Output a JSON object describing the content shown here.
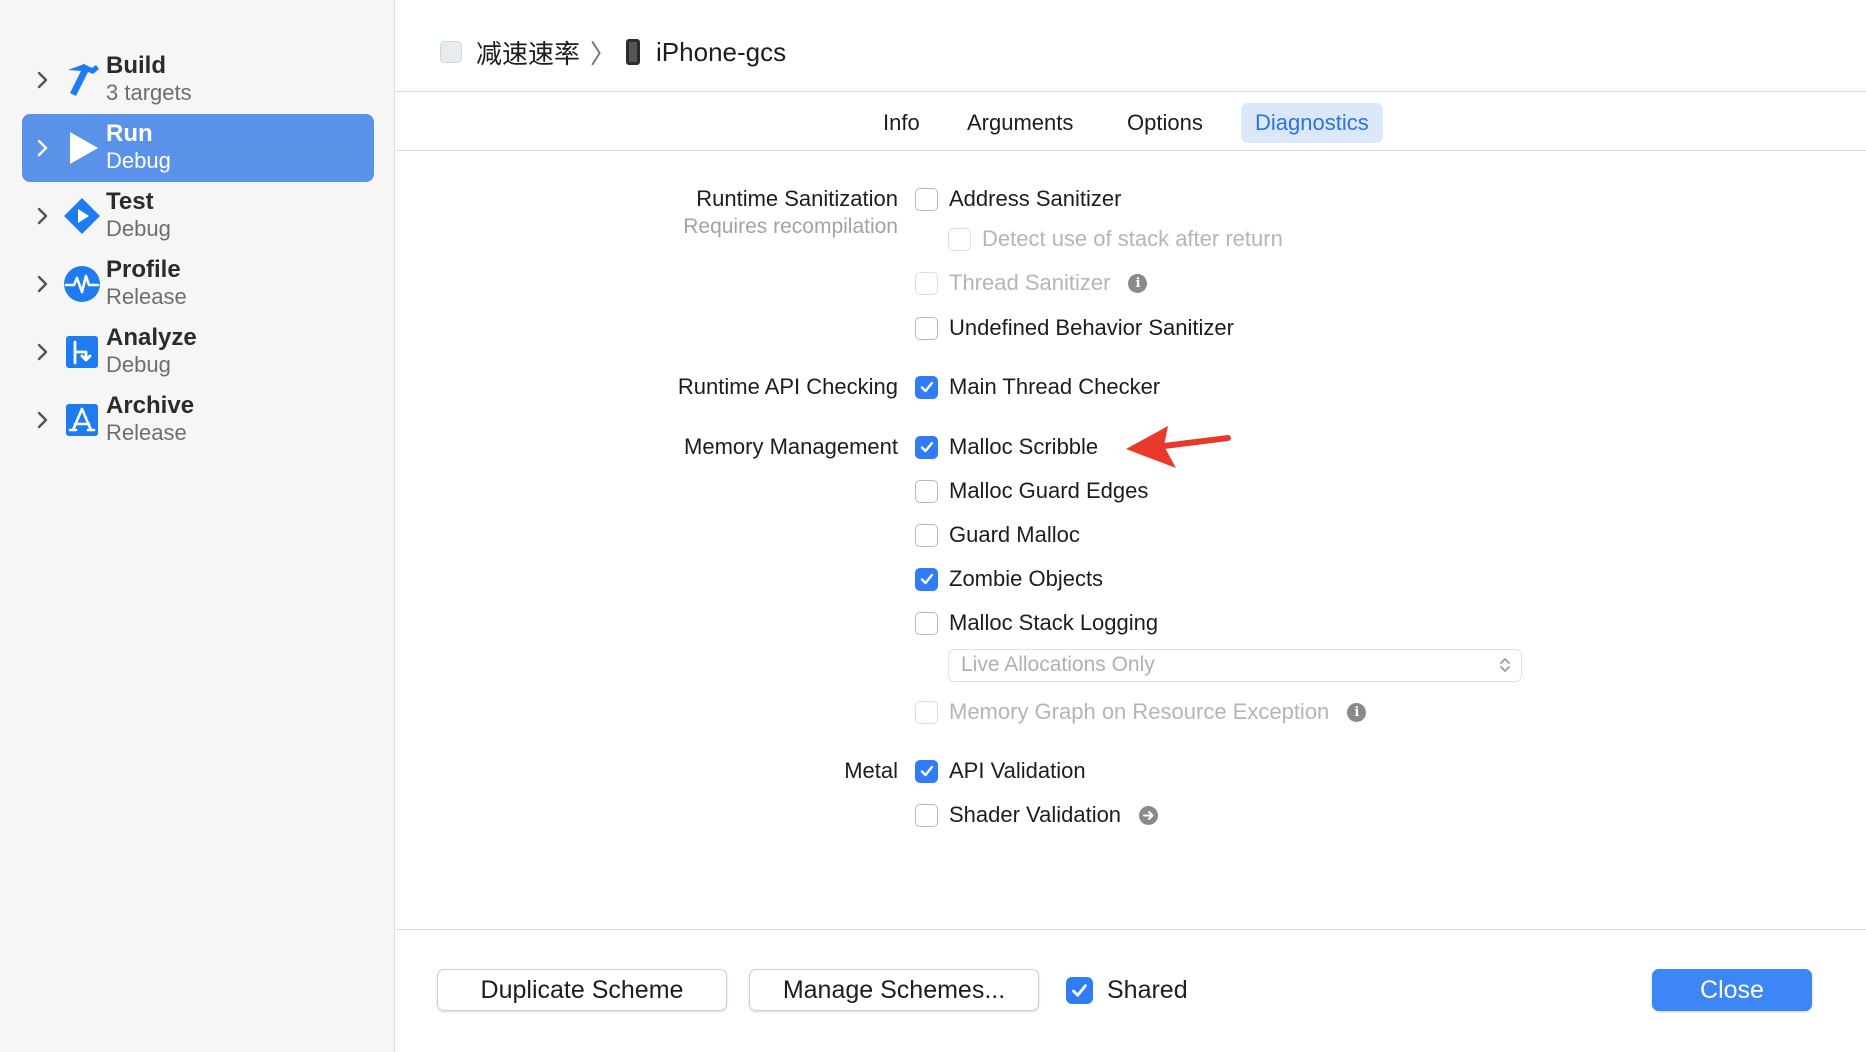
{
  "sidebar": {
    "items": [
      {
        "title": "Build",
        "subtitle": "3 targets",
        "icon": "hammer-icon"
      },
      {
        "title": "Run",
        "subtitle": "Debug",
        "icon": "play-icon"
      },
      {
        "title": "Test",
        "subtitle": "Debug",
        "icon": "test-diamond-icon"
      },
      {
        "title": "Profile",
        "subtitle": "Release",
        "icon": "waveform-icon"
      },
      {
        "title": "Analyze",
        "subtitle": "Debug",
        "icon": "analyze-icon"
      },
      {
        "title": "Archive",
        "subtitle": "Release",
        "icon": "archive-appstore-icon"
      }
    ],
    "selected": "Run"
  },
  "breadcrumb": {
    "project": "减速速率",
    "separator": "〉",
    "device": "iPhone-gcs"
  },
  "tabs": [
    {
      "label": "Info"
    },
    {
      "label": "Arguments"
    },
    {
      "label": "Options"
    },
    {
      "label": "Diagnostics"
    }
  ],
  "active_tab": "Diagnostics",
  "sections": {
    "runtime_sanitization": {
      "label": "Runtime Sanitization",
      "sublabel": "Requires recompilation",
      "options": [
        {
          "label": "Address Sanitizer",
          "checked": false,
          "enabled": true
        },
        {
          "label": "Detect use of stack after return",
          "checked": false,
          "enabled": false
        },
        {
          "label": "Thread Sanitizer",
          "checked": false,
          "enabled": false,
          "info": "i"
        },
        {
          "label": "Undefined Behavior Sanitizer",
          "checked": false,
          "enabled": true
        }
      ]
    },
    "runtime_api_checking": {
      "label": "Runtime API Checking",
      "options": [
        {
          "label": "Main Thread Checker",
          "checked": true,
          "enabled": true
        }
      ]
    },
    "memory_management": {
      "label": "Memory Management",
      "options": [
        {
          "label": "Malloc Scribble",
          "checked": true,
          "enabled": true
        },
        {
          "label": "Malloc Guard Edges",
          "checked": false,
          "enabled": true
        },
        {
          "label": "Guard Malloc",
          "checked": false,
          "enabled": true
        },
        {
          "label": "Zombie Objects",
          "checked": true,
          "enabled": true
        },
        {
          "label": "Malloc Stack Logging",
          "checked": false,
          "enabled": true
        },
        {
          "label": "Memory Graph on Resource Exception",
          "checked": false,
          "enabled": false,
          "info": "i"
        }
      ],
      "stack_logging_select": {
        "value": "Live Allocations Only",
        "enabled": false
      }
    },
    "metal": {
      "label": "Metal",
      "options": [
        {
          "label": "API Validation",
          "checked": true,
          "enabled": true
        },
        {
          "label": "Shader Validation",
          "checked": false,
          "enabled": true
        }
      ]
    }
  },
  "annotation": {
    "color": "#e8392b",
    "target": "Malloc Scribble"
  },
  "footer": {
    "duplicate_label": "Duplicate Scheme",
    "manage_label": "Manage Schemes...",
    "shared_label": "Shared",
    "shared_checked": true,
    "close_label": "Close"
  },
  "colors": {
    "accent": "#2f7cf6",
    "sidebar_selected": "#5a92ea",
    "tab_active_bg": "#dbe7fb",
    "tab_active_text": "#2a74e0",
    "close_button": "#3d86f5"
  }
}
